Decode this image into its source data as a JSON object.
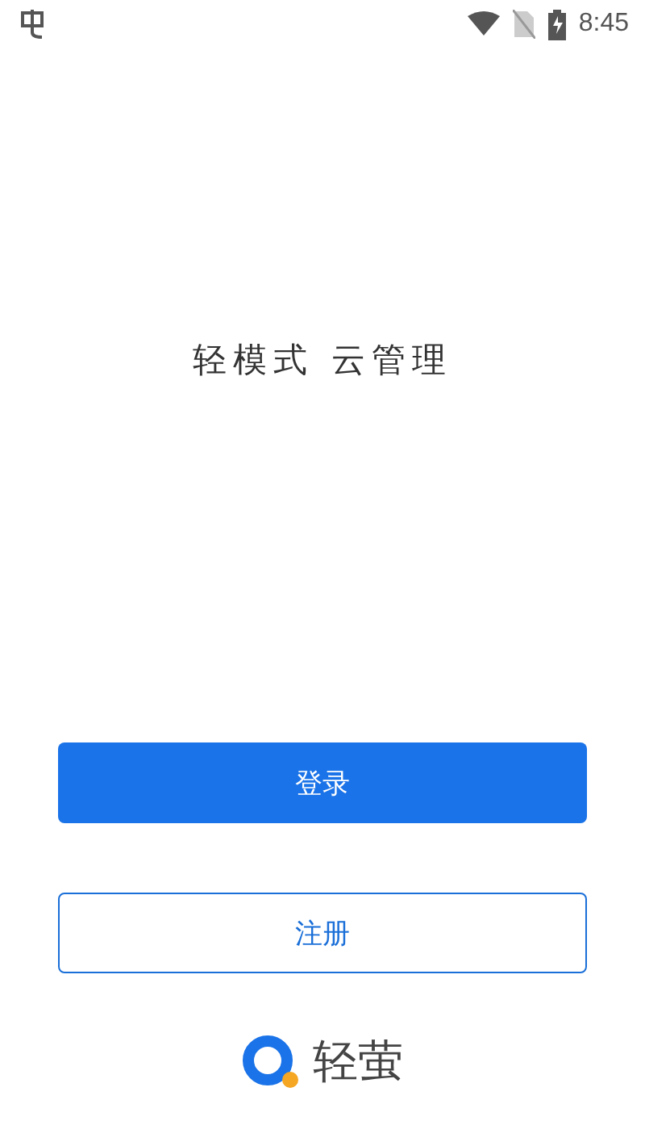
{
  "status_bar": {
    "time": "8:45"
  },
  "slogan": "轻模式 云管理",
  "buttons": [
    {
      "label": "登录",
      "kind": "primary"
    },
    {
      "label": "注册",
      "kind": "outline"
    }
  ],
  "brand": {
    "name": "轻萤"
  }
}
